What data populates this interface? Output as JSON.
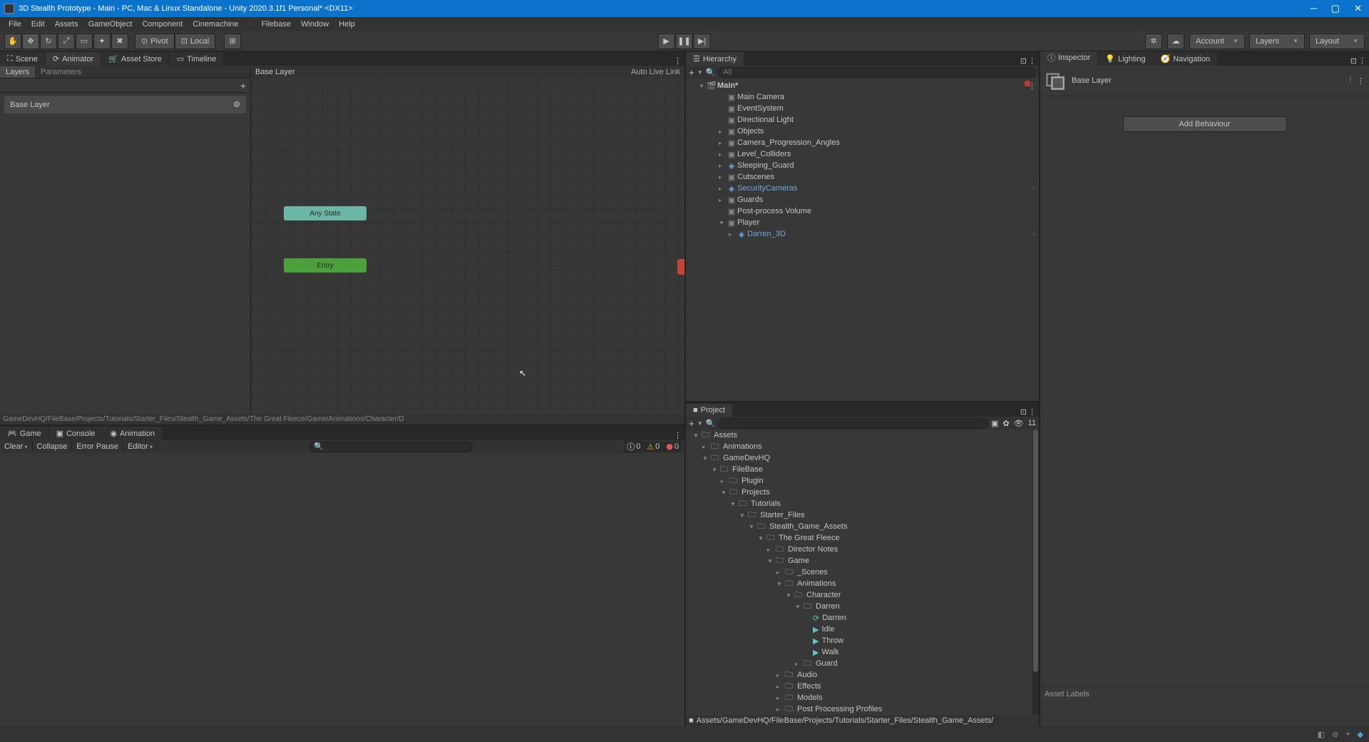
{
  "window": {
    "title": "3D Stealth Prototype - Main - PC, Mac & Linux Standalone - Unity 2020.3.1f1 Personal* <DX11>"
  },
  "menubar": [
    "File",
    "Edit",
    "Assets",
    "GameObject",
    "Component",
    "Cinemachine",
    "Filebase",
    "Window",
    "Help"
  ],
  "toolbar": {
    "pivot": "Pivot",
    "local": "Local",
    "account": "Account",
    "layers": "Layers",
    "layout": "Layout"
  },
  "animator": {
    "tabs": {
      "scene": "Scene",
      "animator": "Animator",
      "assetstore": "Asset Store",
      "timeline": "Timeline"
    },
    "subtabs": {
      "layers": "Layers",
      "parameters": "Parameters"
    },
    "layer_item": "Base Layer",
    "graph_title": "Base Layer",
    "live_link": "Auto Live Link",
    "nodes": {
      "any_state": "Any State",
      "entry": "Entry"
    },
    "breadcrumb": "GameDevHQ/FileBase/Projects/Tutorials/Starter_Files/Stealth_Game_Assets/The Great Fleece/Game/Animations/Character/D"
  },
  "console": {
    "tabs": {
      "game": "Game",
      "console": "Console",
      "animation": "Animation"
    },
    "buttons": {
      "clear": "Clear",
      "collapse": "Collapse",
      "error_pause": "Error Pause",
      "editor": "Editor"
    },
    "filters": {
      "info": "0",
      "warn": "0",
      "error": "0"
    }
  },
  "hierarchy": {
    "tab": "Hierarchy",
    "search_placeholder": "All",
    "scene": "Main*",
    "items": [
      {
        "name": "Main Camera",
        "indent": 2,
        "icon": "cube"
      },
      {
        "name": "EventSystem",
        "indent": 2,
        "icon": "cube"
      },
      {
        "name": "Directional Light",
        "indent": 2,
        "icon": "cube"
      },
      {
        "name": "Objects",
        "indent": 2,
        "icon": "cube",
        "foldout": ">"
      },
      {
        "name": "Camera_Progression_Angles",
        "indent": 2,
        "icon": "cube",
        "foldout": ">"
      },
      {
        "name": "Level_Colliders",
        "indent": 2,
        "icon": "cube",
        "foldout": ">"
      },
      {
        "name": "Sleeping_Guard",
        "indent": 2,
        "icon": "prefab",
        "foldout": ">"
      },
      {
        "name": "Cutscenes",
        "indent": 2,
        "icon": "cube",
        "foldout": ">"
      },
      {
        "name": "SecurityCameras",
        "indent": 2,
        "icon": "prefab",
        "prefab": true,
        "foldout": ">",
        "arrow": true
      },
      {
        "name": "Guards",
        "indent": 2,
        "icon": "cube",
        "foldout": ">"
      },
      {
        "name": "Post-process Volume",
        "indent": 2,
        "icon": "cube"
      },
      {
        "name": "Player",
        "indent": 2,
        "icon": "cube",
        "foldout": "v"
      },
      {
        "name": "Darren_3D",
        "indent": 3,
        "icon": "prefab",
        "prefab": true,
        "foldout": ">",
        "arrow": true
      }
    ]
  },
  "project": {
    "tab": "Project",
    "hidden_count": "11",
    "tree": [
      {
        "name": "Assets",
        "indent": 0,
        "foldout": "v",
        "icon": "folder"
      },
      {
        "name": "Animations",
        "indent": 1,
        "foldout": ">",
        "icon": "folder"
      },
      {
        "name": "GameDevHQ",
        "indent": 1,
        "foldout": "v",
        "icon": "folder"
      },
      {
        "name": "FileBase",
        "indent": 2,
        "foldout": "v",
        "icon": "folder"
      },
      {
        "name": "Plugin",
        "indent": 3,
        "foldout": ">",
        "icon": "folder"
      },
      {
        "name": "Projects",
        "indent": 3,
        "foldout": "v",
        "icon": "folder"
      },
      {
        "name": "Tutorials",
        "indent": 4,
        "foldout": "v",
        "icon": "folder"
      },
      {
        "name": "Starter_Files",
        "indent": 5,
        "foldout": "v",
        "icon": "folder"
      },
      {
        "name": "Stealth_Game_Assets",
        "indent": 6,
        "foldout": "v",
        "icon": "folder"
      },
      {
        "name": "The Great Fleece",
        "indent": 7,
        "foldout": "v",
        "icon": "folder"
      },
      {
        "name": "Director Notes",
        "indent": 8,
        "foldout": ">",
        "icon": "folder"
      },
      {
        "name": "Game",
        "indent": 8,
        "foldout": "v",
        "icon": "folder"
      },
      {
        "name": "_Scenes",
        "indent": 9,
        "foldout": ">",
        "icon": "folder"
      },
      {
        "name": "Animations",
        "indent": 9,
        "foldout": "v",
        "icon": "folder"
      },
      {
        "name": "Character",
        "indent": 10,
        "foldout": "v",
        "icon": "folder"
      },
      {
        "name": "Darren",
        "indent": 11,
        "foldout": "v",
        "icon": "folder"
      },
      {
        "name": "Darren",
        "indent": 12,
        "foldout": "",
        "icon": "anim"
      },
      {
        "name": "Idle",
        "indent": 12,
        "foldout": "",
        "icon": "play"
      },
      {
        "name": "Throw",
        "indent": 12,
        "foldout": "",
        "icon": "play"
      },
      {
        "name": "Walk",
        "indent": 12,
        "foldout": "",
        "icon": "play"
      },
      {
        "name": "Guard",
        "indent": 11,
        "foldout": ">",
        "icon": "folder"
      },
      {
        "name": "Audio",
        "indent": 9,
        "foldout": ">",
        "icon": "folder"
      },
      {
        "name": "Effects",
        "indent": 9,
        "foldout": ">",
        "icon": "folder"
      },
      {
        "name": "Models",
        "indent": 9,
        "foldout": ">",
        "icon": "folder"
      },
      {
        "name": "Post Processing Profiles",
        "indent": 9,
        "foldout": ">",
        "icon": "folder"
      }
    ],
    "footer": "Assets/GameDevHQ/FileBase/Projects/Tutorials/Starter_Files/Stealth_Game_Assets/"
  },
  "inspector": {
    "tabs": {
      "inspector": "Inspector",
      "lighting": "Lighting",
      "navigation": "Navigation"
    },
    "title": "Base Layer",
    "add_behaviour": "Add Behaviour",
    "asset_labels": "Asset Labels"
  }
}
